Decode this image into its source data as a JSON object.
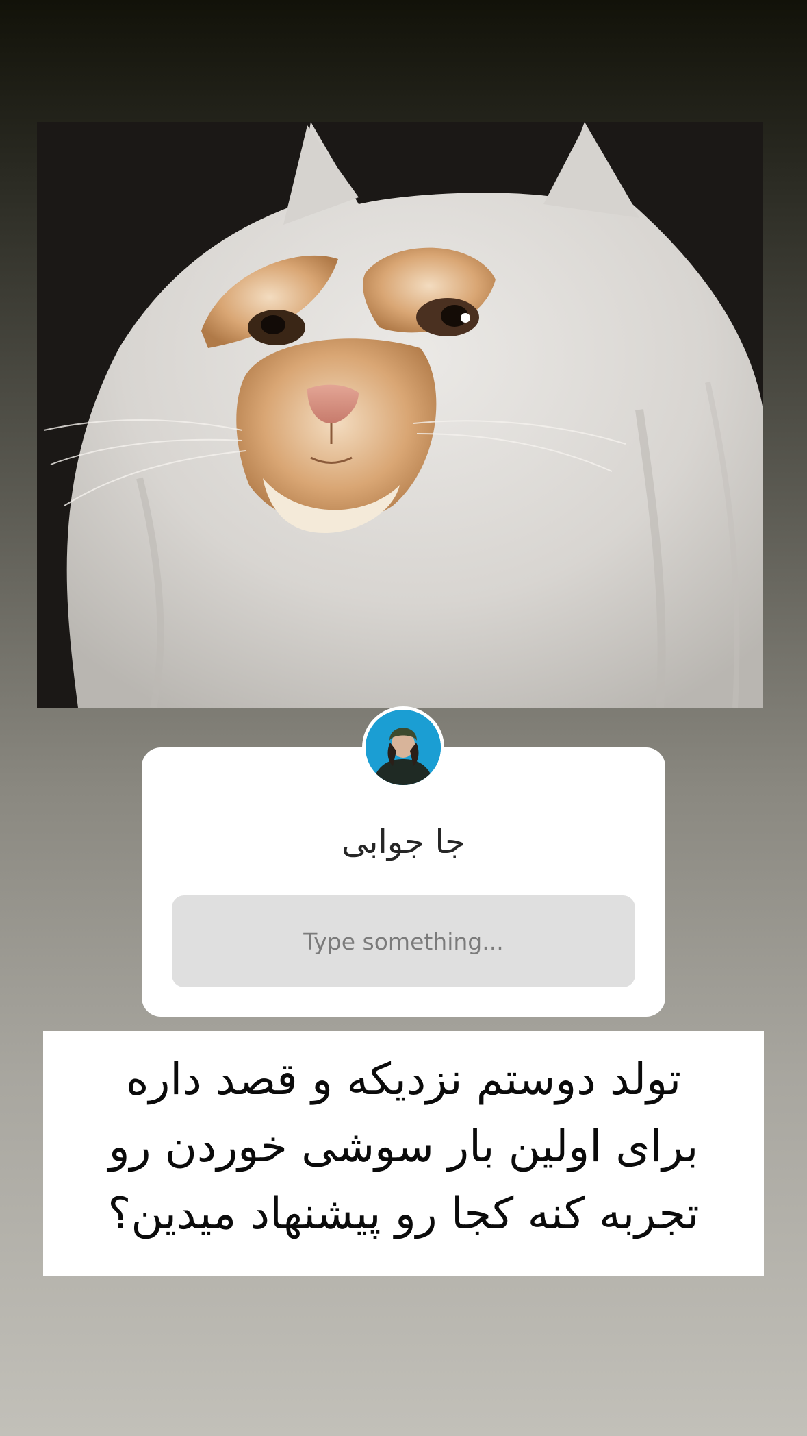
{
  "story": {
    "photo_description": "cat-in-ghost-costume-photo",
    "avatar_icon": "profile-avatar",
    "question_sticker": {
      "title": "جا جوابی",
      "placeholder": "Type something..."
    },
    "caption": {
      "lines": [
        "تولد دوستم نزدیکه و قصد داره",
        "برای اولین بار سوشی خوردن رو",
        "تجربه کنه کجا رو پیشنهاد میدین؟"
      ]
    }
  }
}
